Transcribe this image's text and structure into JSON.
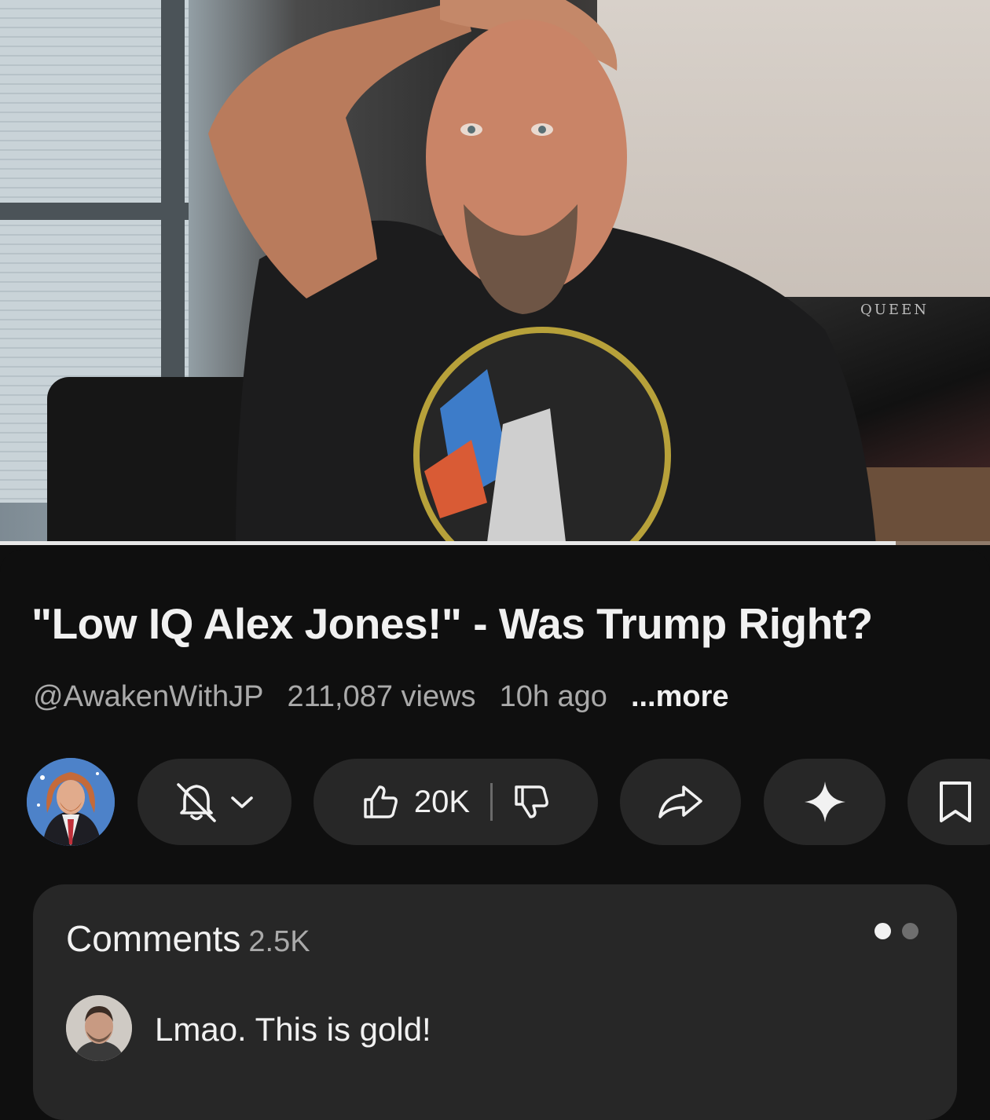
{
  "video": {
    "poster_text": "QUEEN",
    "progress": 0.905
  },
  "details": {
    "title": "\"Low IQ Alex Jones!\" - Was Trump Right?",
    "channel_handle": "@AwakenWithJP",
    "views": "211,087 views",
    "age": "10h ago",
    "more_label": "...more"
  },
  "actions": {
    "subscribe_icon": "bell-off-icon",
    "like_icon": "thumbs-up-icon",
    "like_count": "20K",
    "dislike_icon": "thumbs-down-icon",
    "share_icon": "share-arrow-icon",
    "ask_icon": "sparkle-icon",
    "save_icon": "bookmark-icon"
  },
  "comments": {
    "label": "Comments",
    "count": "2.5K",
    "pager_active": 0,
    "pager_total": 2,
    "top_comment": {
      "text": "Lmao. This is gold!"
    }
  },
  "colors": {
    "background": "#0f0f0f",
    "surface": "#272727",
    "text_primary": "#f1f1f1",
    "text_secondary": "#aaaaaa"
  }
}
